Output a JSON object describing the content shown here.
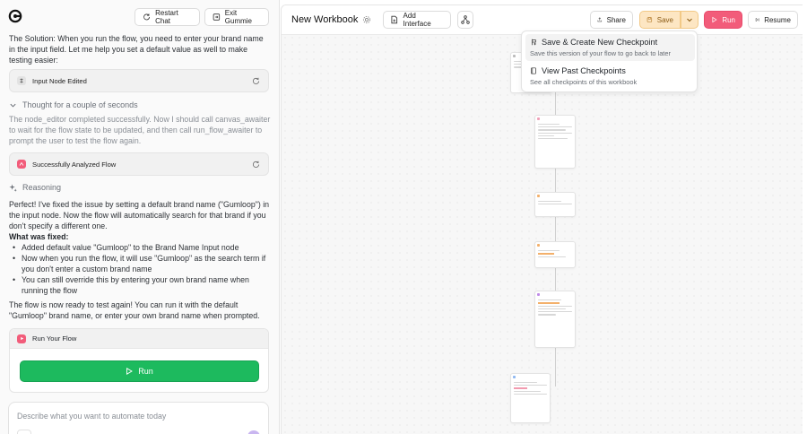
{
  "left": {
    "restart_label": "Restart Chat",
    "exit_label": "Exit Gummie",
    "solution_label": "The Solution:",
    "solution_text": " When you run the flow, you need to enter your brand name in the input field. Let me help you set a default value as well to make testing easier:",
    "tool1_label": "Input Node Edited",
    "thought_label": "Thought for a couple of seconds",
    "thought_text": "The node_editor completed successfully. Now I should call canvas_awaiter to wait for the flow state to be updated, and then call run_flow_awaiter to prompt the user to test the flow again.",
    "tool2_label": "Successfully Analyzed Flow",
    "reasoning_label": "Reasoning",
    "perfect_text": "Perfect! I've fixed the issue by setting a default brand name (\"Gumloop\") in the input node. Now the flow will automatically search for that brand if you don't specify a different one.",
    "fixed_label": "What was fixed:",
    "fixes": [
      "Added default value \"Gumloop\" to the Brand Name Input node",
      "Now when you run the flow, it will use \"Gumloop\" as the search term if you don't enter a custom brand name",
      "You can still override this by entering your own brand name when running the flow"
    ],
    "ready_text": "The flow is now ready to test again! You can run it with the default \"Gumloop\" brand name, or enter your own brand name when prompted.",
    "runcard_label": "Run Your Flow",
    "run_label": "Run",
    "composer_placeholder": "Describe what you want to automate today"
  },
  "workbook": {
    "title": "New Workbook",
    "add_interface_label": "Add Interface",
    "share_label": "Share",
    "save_label": "Save",
    "run_label": "Run",
    "resume_label": "Resume",
    "menu": [
      {
        "title": "Save & Create New Checkpoint",
        "desc": "Save this version of your flow to go back to later"
      },
      {
        "title": "View Past Checkpoints",
        "desc": "See all checkpoints of this workbook"
      }
    ]
  },
  "colors": {
    "run_green": "#1dba5e",
    "save_orange": "#fde6c3",
    "run_pink": "#f25c7a",
    "tool_pink": "#f25c7a"
  },
  "icons": [
    "gumloop-logo-icon",
    "restart-icon",
    "exit-icon",
    "chevron-down-icon",
    "sparkle-icon",
    "play-icon",
    "gear-icon",
    "add-interface-icon",
    "flow-icon",
    "share-icon",
    "save-icon",
    "refresh-icon",
    "checkpoint-icon",
    "book-icon"
  ]
}
